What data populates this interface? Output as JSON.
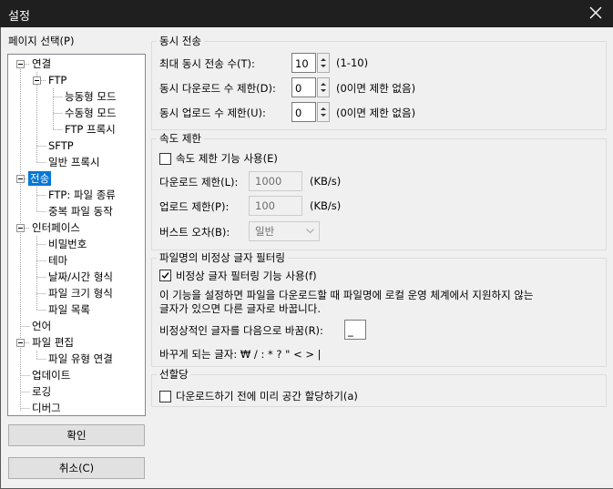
{
  "window": {
    "title": "설정"
  },
  "sidebar": {
    "label": "페이지 선택(P)",
    "tree": [
      "연결",
      "FTP",
      "능동형 모드",
      "수동형 모드",
      "FTP 프록시",
      "SFTP",
      "일반 프록시",
      "전송",
      "FTP: 파일 종류",
      "중복 파일 동작",
      "인터페이스",
      "비밀번호",
      "테마",
      "날짜/시간 형식",
      "파일 크기 형식",
      "파일 목록",
      "언어",
      "파일 편집",
      "파일 유형 연결",
      "업데이트",
      "로깅",
      "디버그"
    ],
    "ok_label": "확인",
    "cancel_label": "취소(C)"
  },
  "concurrent": {
    "title": "동시 전송",
    "max_label": "최대 동시 전송 수(T):",
    "max_value": "10",
    "max_hint": "(1-10)",
    "download_label": "동시 다운로드 수 제한(D):",
    "download_value": "0",
    "download_hint": "(0이면 제한 없음)",
    "upload_label": "동시 업로드 수 제한(U):",
    "upload_value": "0",
    "upload_hint": "(0이면 제한 없음)"
  },
  "speed": {
    "title": "속도 제한",
    "enable_label": "속도 제한 기능 사용(E)",
    "enabled": false,
    "download_label": "다운로드 제한(L):",
    "download_value": "1000",
    "upload_label": "업로드 제한(P):",
    "upload_value": "100",
    "unit": "(KB/s)",
    "burst_label": "버스트 오차(B):",
    "burst_value": "일반"
  },
  "filter": {
    "title": "파일명의 비정상 글자 필터링",
    "enable_label": "비정상 글자 필터링 기능 사용(f)",
    "enabled": true,
    "desc_line1": "이 기능을 설정하면 파일을 다운로드할 때 파일명에 로컬 운영 체계에서 지원하지 않는",
    "desc_line2": "글자가 있으면 다른 글자로 바꿉니다.",
    "replace_label": "비정상적인 글자를 다음으로 바꿈(R):",
    "replace_value": "_",
    "chars_label": "바꾸게 되는 글자: ₩ / : * ? \" < > |"
  },
  "prealloc": {
    "title": "선할당",
    "label": "다운로드하기 전에 미리 공간 할당하기(a)",
    "enabled": false
  }
}
